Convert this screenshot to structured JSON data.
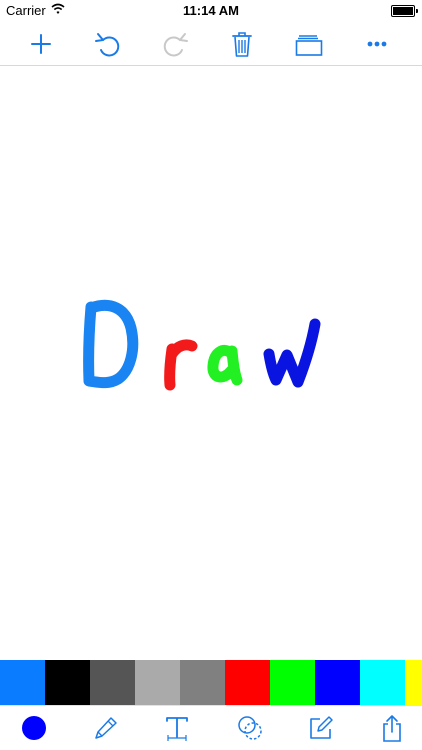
{
  "status_bar": {
    "carrier": "Carrier",
    "time": "11:14 AM",
    "battery_level": 1.0
  },
  "toolbar": {
    "items": [
      {
        "icon": "plus-icon",
        "action": "new"
      },
      {
        "icon": "undo-icon",
        "action": "undo"
      },
      {
        "icon": "redo-icon",
        "action": "redo",
        "disabled": true
      },
      {
        "icon": "trash-icon",
        "action": "delete"
      },
      {
        "icon": "layers-icon",
        "action": "layers"
      },
      {
        "icon": "more-icon",
        "action": "more"
      }
    ],
    "accent_color": "#1a7ae6",
    "disabled_color": "#c8c8c8"
  },
  "canvas": {
    "drawing_text": "Draw",
    "letter_colors": [
      "#1a84f2",
      "#f21a1a",
      "#22f022",
      "#0a14e0"
    ]
  },
  "palette": {
    "colors": [
      "#0a7cff",
      "#000000",
      "#555555",
      "#aaaaaa",
      "#808080",
      "#ff0000",
      "#00ff00",
      "#0000ff",
      "#00ffff",
      "#ffff00"
    ]
  },
  "bottom_bar": {
    "selected_color": "#0000ff",
    "tools": [
      "color-picker-icon",
      "pencil-icon",
      "text-tool-icon",
      "shapes-icon",
      "edit-note-icon",
      "share-icon"
    ]
  }
}
